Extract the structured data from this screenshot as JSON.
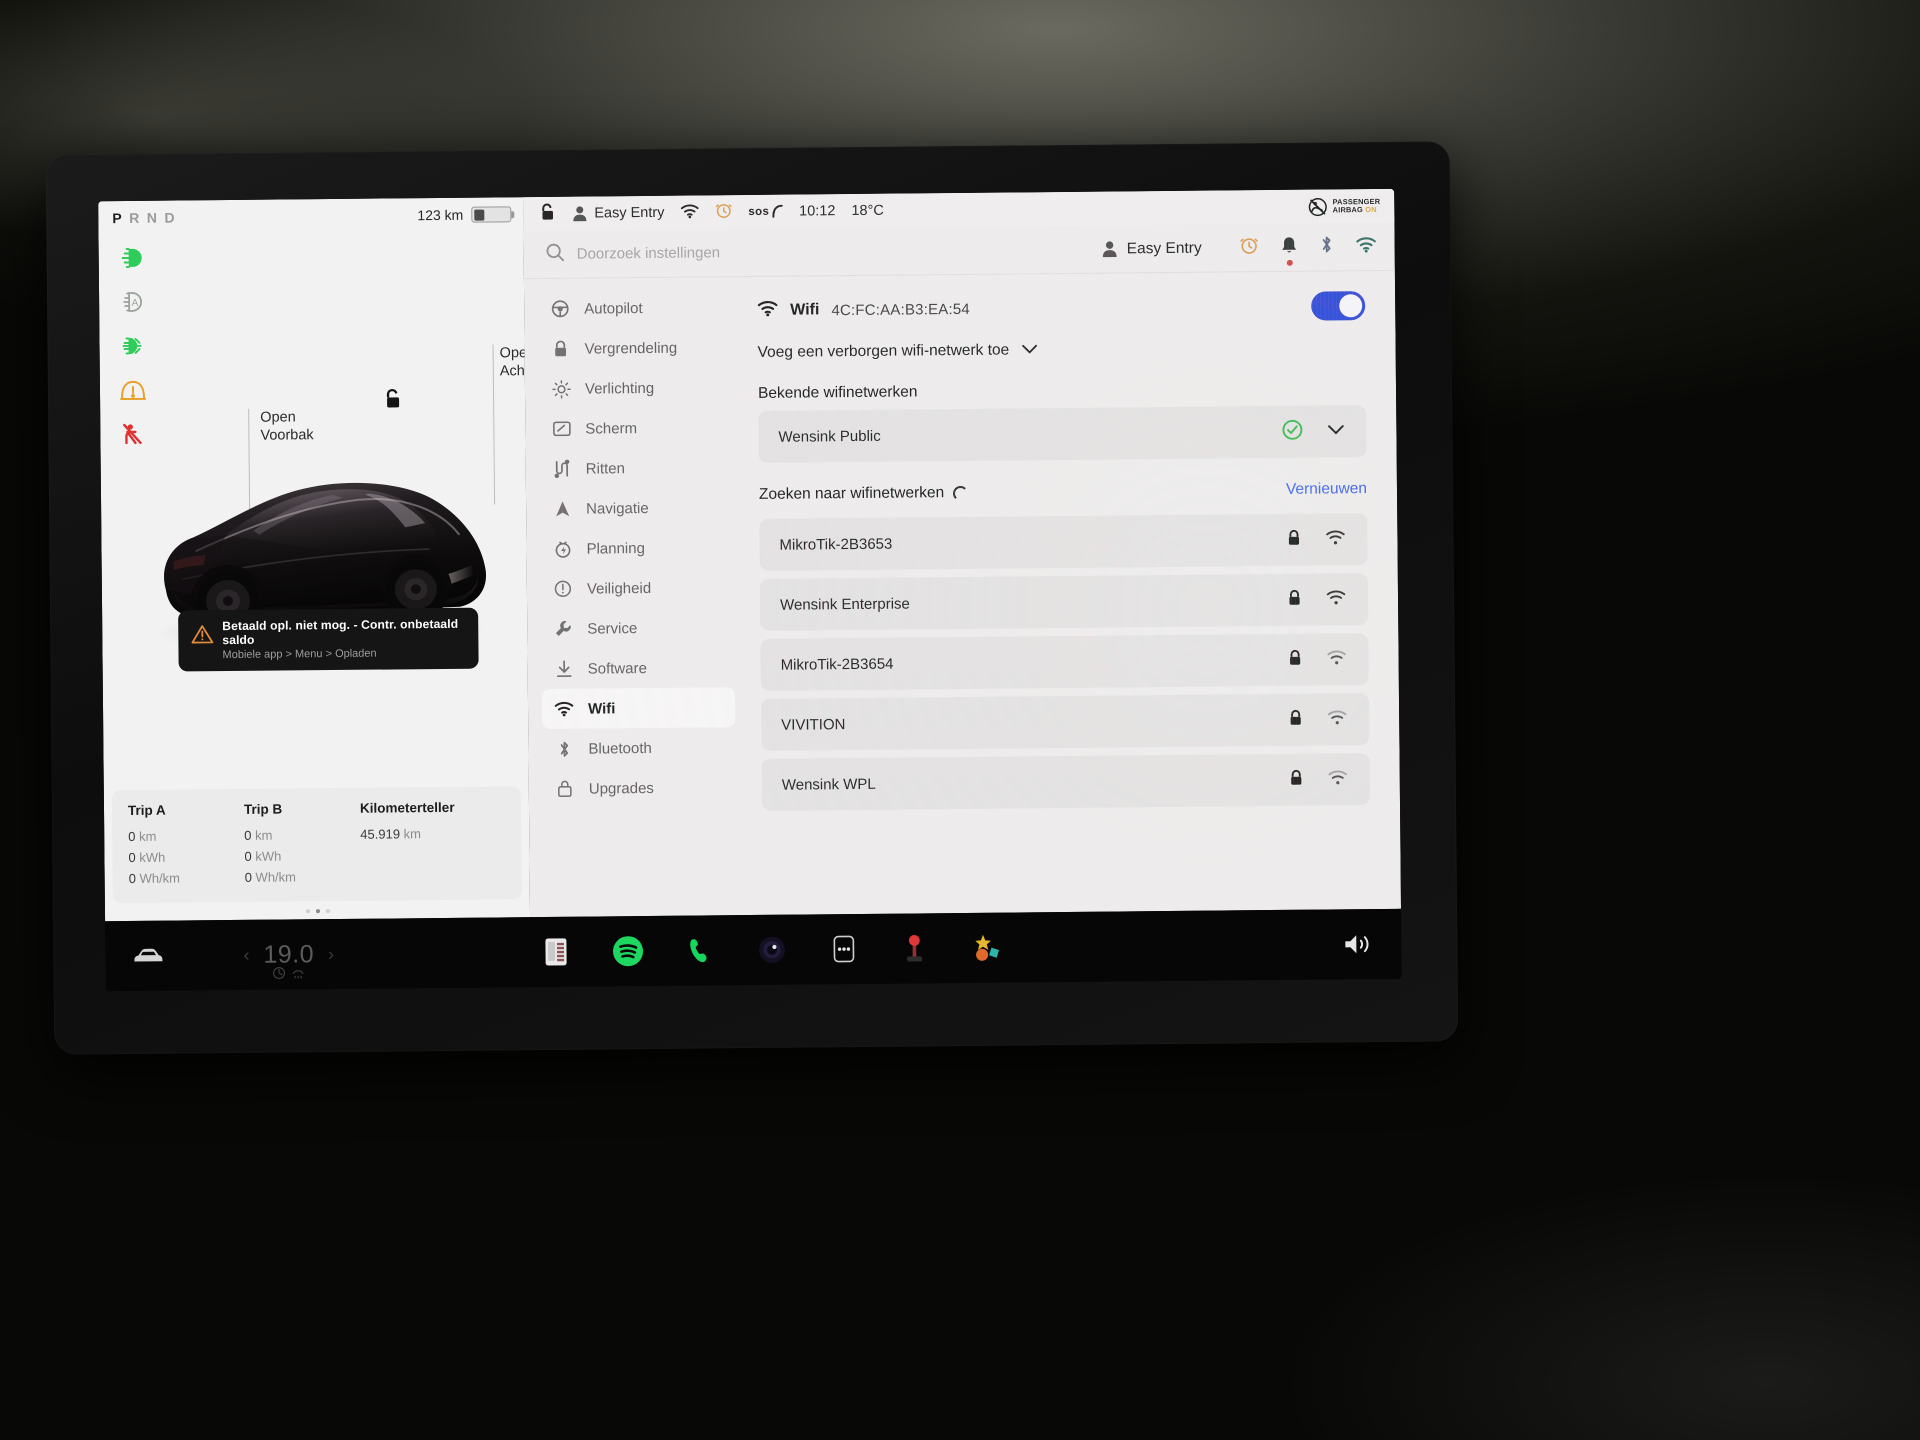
{
  "car": {
    "gear_letters": [
      "P",
      "R",
      "N",
      "D"
    ],
    "gear_active": "P",
    "range": "123 km",
    "battery_percent": 28,
    "telltales": [
      {
        "name": "low-beam-headlight-icon",
        "color": "#2ecc5a"
      },
      {
        "name": "auto-high-beam-icon",
        "color": "#8f9a91"
      },
      {
        "name": "fog-light-icon",
        "color": "#2ecc5a"
      },
      {
        "name": "tire-pressure-warning-icon",
        "color": "#e8a12b"
      },
      {
        "name": "seatbelt-warning-icon",
        "color": "#e03030"
      }
    ],
    "callouts": {
      "frunk": "Open\nVoorbak",
      "frunk_line1": "Open",
      "frunk_line2": "Voorbak",
      "trunk_line1": "Open",
      "trunk_line2": "Achterbak"
    },
    "notification": {
      "title": "Betaald opl. niet mog. - Contr. onbetaald saldo",
      "subtitle": "Mobiele app > Menu > Opladen"
    },
    "trips": [
      {
        "label": "Trip A",
        "distance": "0",
        "distance_unit": "km",
        "energy": "0",
        "energy_unit": "kWh",
        "efficiency": "0",
        "efficiency_unit": "Wh/km"
      },
      {
        "label": "Trip B",
        "distance": "0",
        "distance_unit": "km",
        "energy": "0",
        "energy_unit": "kWh",
        "efficiency": "0",
        "efficiency_unit": "Wh/km"
      }
    ],
    "odometer": {
      "label": "Kilometerteller",
      "value": "45.919",
      "unit": "km"
    }
  },
  "system_bar": {
    "lock_icon": "unlocked-padlock-icon",
    "profile": "Easy Entry",
    "wifi_icon": "wifi-icon",
    "alarm_icon": "alarm-clock-icon",
    "sos": "sos",
    "time": "10:12",
    "temperature": "18°C",
    "airbag_line1": "PASSENGER",
    "airbag_line2": "AIRBAG",
    "airbag_state": "ON"
  },
  "settings": {
    "search": {
      "placeholder": "Doorzoek instellingen",
      "value": ""
    },
    "profile": "Easy Entry",
    "status_icons": [
      "alarm-clock-icon",
      "bell-icon",
      "bluetooth-icon",
      "wifi-icon"
    ],
    "nav": [
      {
        "label": "Autopilot",
        "icon": "steering-wheel-icon",
        "active": false
      },
      {
        "label": "Vergrendeling",
        "icon": "lock-icon",
        "active": false
      },
      {
        "label": "Verlichting",
        "icon": "brightness-icon",
        "active": false
      },
      {
        "label": "Scherm",
        "icon": "display-icon",
        "active": false
      },
      {
        "label": "Ritten",
        "icon": "trips-icon",
        "active": false
      },
      {
        "label": "Navigatie",
        "icon": "navigation-arrow-icon",
        "active": false
      },
      {
        "label": "Planning",
        "icon": "scheduled-charging-icon",
        "active": false
      },
      {
        "label": "Veiligheid",
        "icon": "safety-warning-icon",
        "active": false
      },
      {
        "label": "Service",
        "icon": "wrench-icon",
        "active": false
      },
      {
        "label": "Software",
        "icon": "download-icon",
        "active": false
      },
      {
        "label": "Wifi",
        "icon": "wifi-icon",
        "active": true
      },
      {
        "label": "Bluetooth",
        "icon": "bluetooth-icon",
        "active": false
      },
      {
        "label": "Upgrades",
        "icon": "shopping-bag-icon",
        "active": false
      }
    ]
  },
  "wifi": {
    "title": "Wifi",
    "mac_address": "4C:FC:AA:B3:EA:54",
    "enabled": true,
    "add_hidden_network": "Voeg een verborgen wifi-netwerk toe",
    "known_networks_title": "Bekende wifinetwerken",
    "known_networks": [
      {
        "ssid": "Wensink Public",
        "connected": true,
        "secured": false
      }
    ],
    "scanning_label": "Zoeken naar wifinetwerken",
    "refresh_label": "Vernieuwen",
    "available_networks": [
      {
        "ssid": "MikroTik-2B3653",
        "secured": true,
        "signal": 3
      },
      {
        "ssid": "Wensink Enterprise",
        "secured": true,
        "signal": 3
      },
      {
        "ssid": "MikroTik-2B3654",
        "secured": true,
        "signal": 2
      },
      {
        "ssid": "VIVITION",
        "secured": true,
        "signal": 2
      },
      {
        "ssid": "Wensink WPL",
        "secured": true,
        "signal": 2
      }
    ]
  },
  "dock": {
    "car_icon": "car-icon",
    "temperature": "19.0",
    "prev_label": "‹",
    "next_label": "›",
    "apps": [
      {
        "name": "media-icon"
      },
      {
        "name": "spotify-icon"
      },
      {
        "name": "phone-icon"
      },
      {
        "name": "camera-icon"
      },
      {
        "name": "more-apps-icon"
      },
      {
        "name": "toybox-icon"
      },
      {
        "name": "arcade-icon"
      }
    ],
    "volume_icon": "volume-icon"
  },
  "colors": {
    "accent_blue": "#2f49d7",
    "link_blue": "#3c63e8",
    "connected_green": "#36b84f",
    "warning_orange": "#e8a12b",
    "danger_red": "#e03030"
  }
}
